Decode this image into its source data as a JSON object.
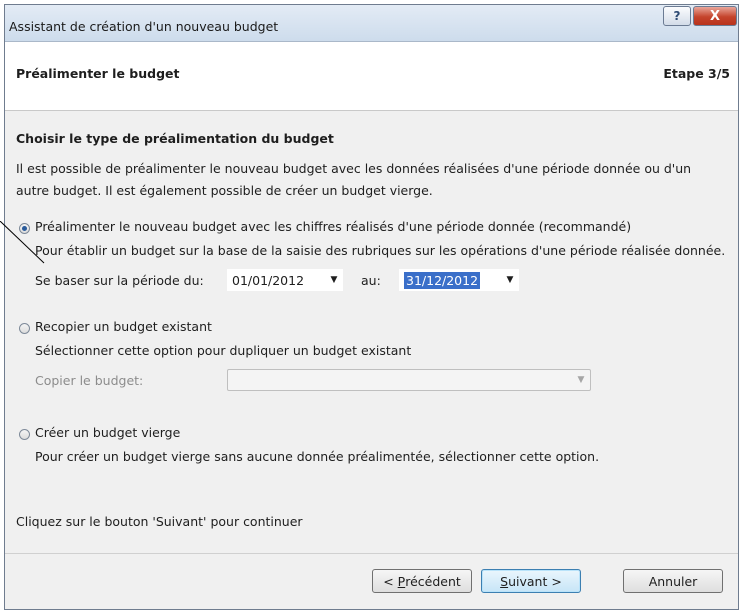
{
  "window": {
    "title": "Assistant de création d'un nouveau budget",
    "help_label": "?",
    "close_label": "X"
  },
  "header": {
    "title": "Préalimenter le budget",
    "step": "Etape 3/5"
  },
  "content": {
    "section_title": "Choisir le type de préalimentation du budget",
    "intro_line1": "Il est possible de préalimenter le nouveau budget avec les données réalisées d'une période donnée ou d'un",
    "intro_line2": "autre budget. Il est également possible de créer un budget vierge.",
    "option1": {
      "label": "Préalimenter le nouveau budget avec les chiffres réalisés d'une période donnée (recommandé)",
      "description": "Pour établir un budget sur la base de la saisie des rubriques sur les opérations d'une période réalisée donnée.",
      "period_label": "Se baser sur la période du:",
      "date_from": "01/01/2012",
      "to_label": "au:",
      "date_to": "31/12/2012",
      "selected": true
    },
    "option2": {
      "label": "Recopier un budget existant",
      "description": "Sélectionner cette option pour dupliquer un budget existant",
      "copy_label": "Copier le budget:",
      "copy_value": "",
      "selected": false
    },
    "option3": {
      "label": "Créer un budget vierge",
      "description": "Pour créer un budget vierge sans aucune donnée préalimentée, sélectionner cette option.",
      "selected": false
    },
    "hint": "Cliquez sur le bouton 'Suivant' pour continuer"
  },
  "footer": {
    "prev_hotkey": "P",
    "prev_rest": "récédent",
    "prev_prefix": "< ",
    "next_hotkey": "S",
    "next_rest": "uivant >",
    "cancel": "Annuler"
  },
  "icons": {
    "dropdown": "chevron-down-icon",
    "radio": "radio-icon"
  },
  "colors": {
    "accent": "#3a6fc9",
    "close_button": "#c5442c",
    "titlebar": "#cddcec"
  }
}
